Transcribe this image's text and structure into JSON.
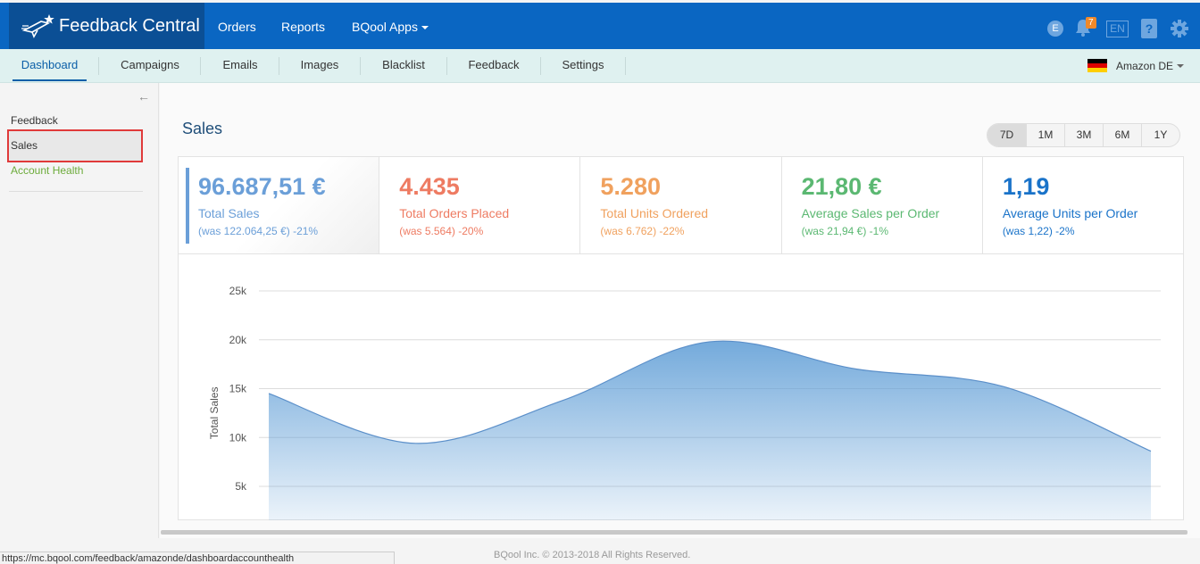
{
  "app": {
    "brand": "Feedback Central"
  },
  "topnav": {
    "links": [
      "Orders",
      "Reports",
      "BQool Apps"
    ],
    "user_initial": "E",
    "notification_count": "7",
    "language": "EN"
  },
  "subnav": {
    "tabs": [
      "Dashboard",
      "Campaigns",
      "Emails",
      "Images",
      "Blacklist",
      "Feedback",
      "Settings"
    ],
    "active_tab": "Dashboard",
    "marketplace": "Amazon DE"
  },
  "sidebar": {
    "items": [
      "Feedback",
      "Sales",
      "Account Health"
    ],
    "selected": "Sales"
  },
  "main": {
    "title": "Sales",
    "ranges": [
      "7D",
      "1M",
      "3M",
      "6M",
      "1Y"
    ],
    "selected_range": "7D",
    "stats": [
      {
        "value": "96.687,51 €",
        "label": "Total Sales",
        "compare": "(was 122.064,25 €) -21%",
        "color": "#6b9fd8"
      },
      {
        "value": "4.435",
        "label": "Total Orders Placed",
        "compare": "(was 5.564) -20%",
        "color": "#ee7b62"
      },
      {
        "value": "5.280",
        "label": "Total Units Ordered",
        "compare": "(was 6.762) -22%",
        "color": "#f0a15e"
      },
      {
        "value": "21,80 €",
        "label": "Average Sales per Order",
        "compare": "(was 21,94 €) -1%",
        "color": "#5bb872"
      },
      {
        "value": "1,19",
        "label": "Average Units per Order",
        "compare": "(was 1,22) -2%",
        "color": "#1a73c9"
      }
    ]
  },
  "chart_data": {
    "type": "area",
    "ylabel": "Total Sales",
    "y_ticks": [
      "5k",
      "10k",
      "15k",
      "20k",
      "25k"
    ],
    "ylim": [
      0,
      25000
    ],
    "grid": true,
    "series": [
      {
        "values": [
          14500,
          9400,
          13800,
          19800,
          17000,
          15200,
          8600
        ]
      }
    ],
    "color": "#5b9bd5"
  },
  "footer": {
    "copyright": "BQool Inc. © 2013-2018 All Rights Reserved.",
    "status_url": "https://mc.bqool.com/feedback/amazonde/dashboardaccounthealth"
  }
}
